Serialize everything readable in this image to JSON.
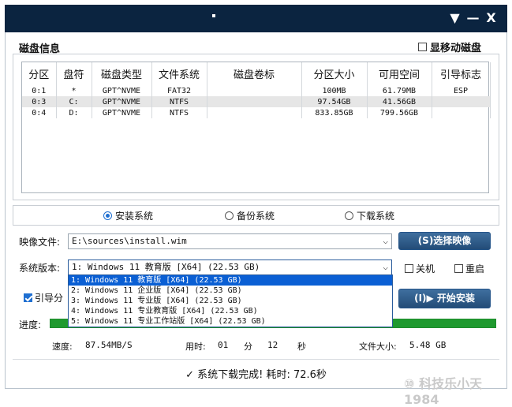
{
  "titlebar": {
    "controls": [
      "▼",
      "—",
      "X"
    ]
  },
  "disk_info": {
    "title": "磁盘信息",
    "show_removable_label": "显移动磁盘",
    "columns": [
      "分区",
      "盘符",
      "磁盘类型",
      "文件系统",
      "磁盘卷标",
      "分区大小",
      "可用空间",
      "引导标志"
    ],
    "rows": [
      [
        "0:1",
        "*",
        "GPT^NVME",
        "FAT32",
        "",
        "100MB",
        "61.79MB",
        "ESP"
      ],
      [
        "0:3",
        "C:",
        "GPT^NVME",
        "NTFS",
        "",
        "97.54GB",
        "41.56GB",
        ""
      ],
      [
        "0:4",
        "D:",
        "GPT^NVME",
        "NTFS",
        "",
        "833.85GB",
        "799.56GB",
        ""
      ]
    ]
  },
  "modes": {
    "install": "安装系统",
    "backup": "备份系统",
    "download": "下载系统"
  },
  "image": {
    "label": "映像文件:",
    "value": "E:\\sources\\install.wim",
    "button": "(S)选择映像"
  },
  "version": {
    "label": "系统版本:",
    "selected": "1: Windows 11 教育版 [X64] (22.53 GB)",
    "options": [
      "1: Windows 11 教育版 [X64] (22.53 GB)",
      "2: Windows 11 企业版 [X64] (22.53 GB)",
      "3: Windows 11 专业版 [X64] (22.53 GB)",
      "4: Windows 11 专业教育版 [X64] (22.53 GB)",
      "5: Windows 11 专业工作站版 [X64] (22.53 GB)"
    ]
  },
  "options": {
    "shutdown": "关机",
    "restart": "重启",
    "boot_partial": "引导分"
  },
  "actions": {
    "start_install": "(I)▶ 开始安装"
  },
  "progress": {
    "label": "进度:",
    "fraction": 1.0
  },
  "stats": {
    "speed_label": "速度:",
    "speed_value": "87.54MB/S",
    "elapsed_label": "用时:",
    "elapsed_min_value": "01",
    "min_unit": "分",
    "elapsed_sec_value": "12",
    "sec_unit": "秒",
    "file_size_label": "文件大小:",
    "file_size_value": "5.48 GB"
  },
  "status": {
    "message": "✓ 系统下载完成! 耗时: 72.6秒"
  },
  "watermark": {
    "text": "⑩ 科技乐小天1984"
  },
  "colors": {
    "titlebar": "#0b2440",
    "accent_button": "#27568a",
    "progress_fill": "#1f9a2f",
    "dropdown_highlight": "#0a5fd4"
  }
}
